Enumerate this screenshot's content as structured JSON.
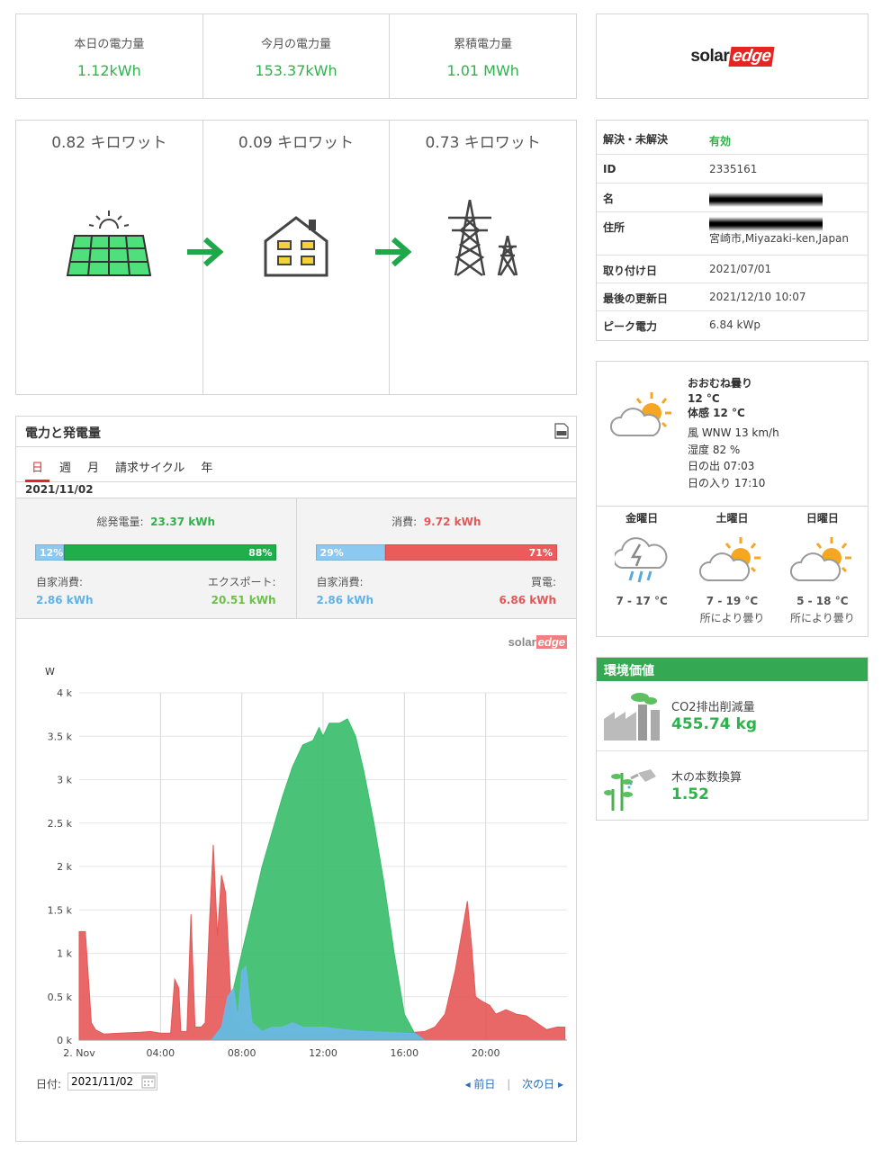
{
  "energy_summary": [
    {
      "label": "本日の電力量",
      "value": "1.12kWh"
    },
    {
      "label": "今月の電力量",
      "value": "153.37kWh"
    },
    {
      "label": "累積電力量",
      "value": "1.01 MWh"
    }
  ],
  "brand": {
    "part1": "solar",
    "part2": "edge"
  },
  "power_flow": {
    "pv": "0.82 キロワット",
    "load": "0.09 キロワット",
    "grid": "0.73 キロワット"
  },
  "site_info": {
    "status_key": "解決・未解決",
    "status_val": "有効",
    "id_key": "ID",
    "id_val": "2335161",
    "name_key": "名",
    "address_key": "住所",
    "address_val": "宮崎市,Miyazaki-ken,Japan",
    "install_key": "取り付け日",
    "install_val": "2021/07/01",
    "updated_key": "最後の更新日",
    "updated_val": "2021/12/10 10:07",
    "peak_key": "ピーク電力",
    "peak_val": "6.84 kWp"
  },
  "weather": {
    "condition": "おおむね曇り",
    "temp": "12 °C",
    "feels": "体感 12 °C",
    "wind": "風 WNW 13 km/h",
    "humidity": "湿度 82 %",
    "sunrise": "日の出 07:03",
    "sunset": "日の入り 17:10",
    "forecast": [
      {
        "day": "金曜日",
        "temp": "7 - 17 °C",
        "desc": "",
        "icon": "thunder-rain-icon"
      },
      {
        "day": "土曜日",
        "temp": "7 - 19 °C",
        "desc": "所により曇り",
        "icon": "partly-cloudy-icon"
      },
      {
        "day": "日曜日",
        "temp": "5 - 18 °C",
        "desc": "所により曇り",
        "icon": "partly-cloudy-icon"
      }
    ]
  },
  "environment": {
    "header": "環境価値",
    "co2_label": "CO2排出削減量",
    "co2_value": "455.74 kg",
    "trees_label": "木の本数換算",
    "trees_value": "1.52"
  },
  "chart_panel": {
    "title": "電力と発電量",
    "tabs": [
      "日",
      "週",
      "月",
      "請求サイクル",
      "年"
    ],
    "date": "2021/11/02",
    "production": {
      "total_label": "総発電量:",
      "total_value": "23.37 kWh",
      "self_pct": "12%",
      "export_pct": "88%",
      "self_label": "自家消費:",
      "self_value": "2.86 kWh",
      "export_label": "エクスポート:",
      "export_value": "20.51 kWh"
    },
    "consumption": {
      "total_label": "消費:",
      "total_value": "9.72 kWh",
      "self_pct": "29%",
      "import_pct": "71%",
      "self_label": "自家消費:",
      "self_value": "2.86 kWh",
      "import_label": "買電:",
      "import_value": "6.86 kWh"
    },
    "footer": {
      "date_label": "日付:",
      "date_value": "2021/11/02",
      "prev": "前日",
      "sep": "|",
      "next": "次の日"
    }
  },
  "colors": {
    "consumption": "#e55757",
    "production": "#36bd6a",
    "self": "#6bb8e8"
  },
  "chart_data": {
    "type": "area",
    "ylabel": "W",
    "ylim": [
      0,
      4000
    ],
    "yticks": [
      "0 k",
      "0.5 k",
      "1 k",
      "1.5 k",
      "2 k",
      "2.5 k",
      "3 k",
      "3.5 k",
      "4 k"
    ],
    "xticks": [
      "2. Nov",
      "04:00",
      "08:00",
      "12:00",
      "16:00",
      "20:00"
    ],
    "xlim": [
      0,
      24
    ],
    "series": [
      {
        "name": "消費",
        "color": "#e55757",
        "points": [
          [
            0,
            1250
          ],
          [
            0.3,
            1250
          ],
          [
            0.6,
            200
          ],
          [
            0.8,
            120
          ],
          [
            1.2,
            70
          ],
          [
            2,
            80
          ],
          [
            3,
            90
          ],
          [
            3.5,
            100
          ],
          [
            4,
            80
          ],
          [
            4.5,
            80
          ],
          [
            4.7,
            700
          ],
          [
            4.9,
            600
          ],
          [
            5,
            100
          ],
          [
            5.3,
            100
          ],
          [
            5.5,
            1450
          ],
          [
            5.7,
            150
          ],
          [
            6,
            150
          ],
          [
            6.2,
            200
          ],
          [
            6.4,
            1300
          ],
          [
            6.6,
            2250
          ],
          [
            6.8,
            1200
          ],
          [
            7.0,
            1900
          ],
          [
            7.2,
            1700
          ],
          [
            7.5,
            300
          ],
          [
            7.8,
            200
          ],
          [
            8.0,
            100
          ],
          [
            8.5,
            80
          ],
          [
            9,
            80
          ],
          [
            10,
            80
          ],
          [
            11,
            80
          ],
          [
            12,
            80
          ],
          [
            13,
            80
          ],
          [
            14,
            80
          ],
          [
            15,
            80
          ],
          [
            16,
            80
          ],
          [
            17,
            100
          ],
          [
            17.5,
            150
          ],
          [
            18,
            300
          ],
          [
            18.5,
            800
          ],
          [
            18.8,
            1200
          ],
          [
            19.1,
            1600
          ],
          [
            19.3,
            1100
          ],
          [
            19.5,
            500
          ],
          [
            19.8,
            450
          ],
          [
            20.2,
            400
          ],
          [
            20.5,
            300
          ],
          [
            21,
            350
          ],
          [
            21.5,
            300
          ],
          [
            22,
            280
          ],
          [
            22.5,
            200
          ],
          [
            23,
            120
          ],
          [
            23.5,
            150
          ],
          [
            23.9,
            150
          ]
        ]
      },
      {
        "name": "総発電量",
        "color": "#36bd6a",
        "points": [
          [
            6.5,
            0
          ],
          [
            7.2,
            200
          ],
          [
            7.7,
            700
          ],
          [
            8.1,
            1100
          ],
          [
            8.5,
            1500
          ],
          [
            9,
            2000
          ],
          [
            9.5,
            2400
          ],
          [
            10,
            2800
          ],
          [
            10.5,
            3150
          ],
          [
            11,
            3400
          ],
          [
            11.5,
            3450
          ],
          [
            11.8,
            3600
          ],
          [
            12,
            3500
          ],
          [
            12.3,
            3650
          ],
          [
            12.8,
            3650
          ],
          [
            13.2,
            3700
          ],
          [
            13.6,
            3500
          ],
          [
            14,
            3100
          ],
          [
            14.5,
            2500
          ],
          [
            15,
            1800
          ],
          [
            15.5,
            1000
          ],
          [
            16,
            300
          ],
          [
            16.5,
            80
          ],
          [
            17,
            0
          ]
        ]
      },
      {
        "name": "自家消費",
        "color": "#6bb8e8",
        "points": [
          [
            6.5,
            0
          ],
          [
            7,
            150
          ],
          [
            7.3,
            500
          ],
          [
            7.6,
            600
          ],
          [
            7.8,
            250
          ],
          [
            8.0,
            800
          ],
          [
            8.2,
            850
          ],
          [
            8.5,
            200
          ],
          [
            9,
            100
          ],
          [
            9.5,
            150
          ],
          [
            10,
            150
          ],
          [
            10.5,
            200
          ],
          [
            11,
            150
          ],
          [
            12,
            150
          ],
          [
            13,
            120
          ],
          [
            14,
            100
          ],
          [
            15,
            90
          ],
          [
            16,
            80
          ],
          [
            16.5,
            80
          ],
          [
            17,
            0
          ]
        ]
      }
    ]
  }
}
